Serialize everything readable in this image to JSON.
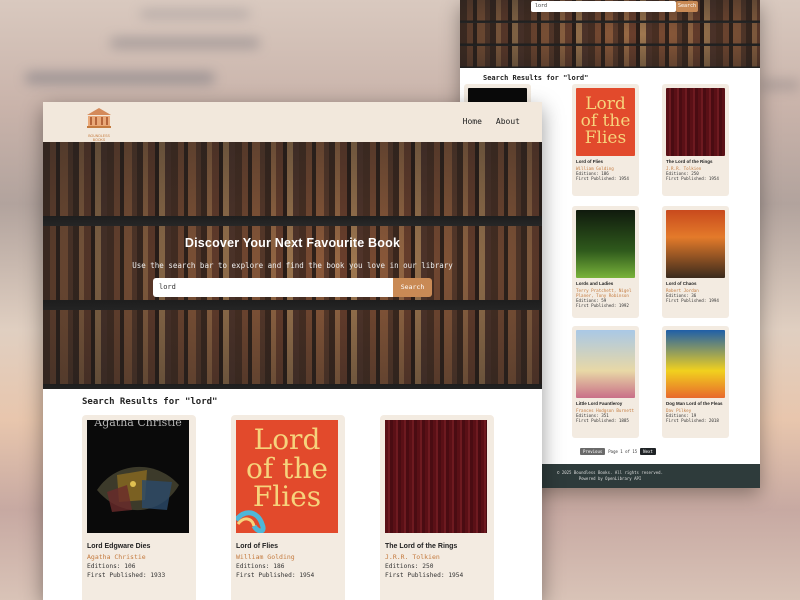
{
  "back_window": {
    "search_value": "lord",
    "search_button": "Search",
    "results_heading": "Search Results for \"lord\"",
    "books": [
      {
        "title": "Lord of Flies",
        "author": "William Golding",
        "editions": "Editions: 186",
        "published": "First Published: 1954",
        "cover": "lotf"
      },
      {
        "title": "The Lord of the Rings",
        "author": "J.R.R. Tolkien",
        "editions": "Editions: 250",
        "published": "First Published: 1954",
        "cover": "lotr"
      },
      {
        "title": "Lords and Ladies",
        "author": "Terry Pratchett, Nigel Planer, Tony Robinson",
        "editions": "Editions: 59",
        "published": "First Published: 1992",
        "cover": "pratchett"
      },
      {
        "title": "Lord of Chaos",
        "author": "Robert Jordan",
        "editions": "Editions: 36",
        "published": "First Published: 1994",
        "cover": "chaos"
      },
      {
        "title": "Little Lord Fauntleroy",
        "author": "Frances Hodgson Burnett",
        "editions": "Editions: 351",
        "published": "First Published: 1885",
        "cover": "little"
      },
      {
        "title": "Dog Man Lord of the Fleas",
        "author": "Dav Pilkey",
        "editions": "Editions: 19",
        "published": "First Published: 2018",
        "cover": "dog"
      }
    ],
    "pagination": {
      "prev": "Previous",
      "page_text": "Page 1 of 15",
      "next": "Next"
    },
    "footer": {
      "line1": "© 2025 Boundless Books. All rights reserved.",
      "line2": "Powered by OpenLibrary API"
    }
  },
  "front_window": {
    "logo_text": "BOUNDLESS BOOKS",
    "nav": {
      "home": "Home",
      "about": "About"
    },
    "hero": {
      "title": "Discover Your Next Favourite Book",
      "subtitle": "Use the search bar to explore and find the book you love in our library",
      "search_value": "lord",
      "search_button": "Search"
    },
    "results_heading": "Search Results for \"lord\"",
    "books": [
      {
        "title": "Lord Edgware Dies",
        "author": "Agatha Christie",
        "editions": "Editions: 106",
        "published": "First Published: 1933",
        "cover_text": "Agatha Christie"
      },
      {
        "title": "Lord of Flies",
        "author": "William Golding",
        "editions": "Editions: 186",
        "published": "First Published: 1954",
        "cover_text": "Lord of the Flies"
      },
      {
        "title": "The Lord of the Rings",
        "author": "J.R.R. Tolkien",
        "editions": "Editions: 250",
        "published": "First Published: 1954",
        "cover_text": ""
      }
    ]
  },
  "colors": {
    "accent": "#c98a55",
    "author": "#c47a3e",
    "card_bg": "#f3ebe1",
    "nav_bg": "#f2e8dc",
    "footer_bg": "#2e3b3b"
  }
}
